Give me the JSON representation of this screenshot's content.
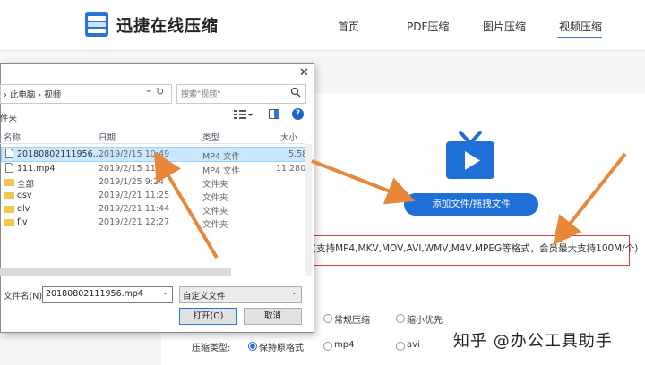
{
  "site": {
    "logo_text": "迅捷在线压缩",
    "nav": [
      "首页",
      "PDF压缩",
      "图片压缩",
      "视频压缩"
    ],
    "active_nav": "视频压缩"
  },
  "upload": {
    "button_label": "添加文件/拖拽文件",
    "formats_note": "(支持MP4,MKV,MOV,AVI,WMV,M4V,MPEG等格式，会员最大支持100M/个)"
  },
  "compress_mode": {
    "options": [
      "常规压缩",
      "缩小优先"
    ]
  },
  "compress_type": {
    "label": "压缩类型:",
    "options": [
      "保持原格式",
      "mp4",
      "avi"
    ],
    "selected": "保持原格式"
  },
  "watermark": "知乎 @办公工具助手",
  "dialog": {
    "close_glyph": "✕",
    "address": "› 此电脑 › 视频",
    "search_placeholder": "搜索\"视频\"",
    "toolbar_left": "件夹",
    "columns": [
      "名称",
      "日期",
      "类型",
      "大小"
    ],
    "files": [
      {
        "name": "20180802111956....",
        "date": "2019/2/15 10:49",
        "type": "MP4 文件",
        "size": "5,581",
        "kind": "file",
        "selected": true
      },
      {
        "name": "111.mp4",
        "date": "2019/2/15 11:05",
        "type": "MP4 文件",
        "size": "11,280",
        "kind": "file",
        "selected": false
      },
      {
        "name": "全部",
        "date": "2019/1/25 9:24",
        "type": "文件夹",
        "size": "",
        "kind": "folder",
        "selected": false
      },
      {
        "name": "qsv",
        "date": "2019/2/21 11:25",
        "type": "文件夹",
        "size": "",
        "kind": "folder",
        "selected": false
      },
      {
        "name": "qlv",
        "date": "2019/2/21 11:44",
        "type": "文件夹",
        "size": "",
        "kind": "folder",
        "selected": false
      },
      {
        "name": "flv",
        "date": "2019/2/21 12:27",
        "type": "文件夹",
        "size": "",
        "kind": "folder",
        "selected": false
      }
    ],
    "filename_label": "文件名(N):",
    "filename_value": "20180802111956.mp4",
    "filetype_value": "自定义文件",
    "open_label": "打开(O)",
    "cancel_label": "取消",
    "help_glyph": "?"
  },
  "colors": {
    "accent": "#1f6fd8",
    "annotation_arrow": "#e8873a",
    "highlight_box": "#d93a3a",
    "selection": "#cce8ff"
  }
}
